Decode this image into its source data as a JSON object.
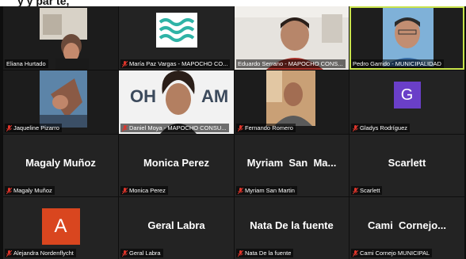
{
  "colors": {
    "tile_bg": "#232323",
    "active_border": "#c8e24a",
    "mute_icon": "#e0352b",
    "avatar_g": "#6a3fc8",
    "avatar_a": "#d9461f"
  },
  "participants": [
    {
      "name": "Eliana Hurtado",
      "muted": false,
      "type": "video"
    },
    {
      "name": "María Paz Vargas - MAPOCHO CO...",
      "muted": true,
      "type": "logo"
    },
    {
      "name": "Eduardo Serrano - MAPOCHO CONS...",
      "muted": false,
      "type": "video"
    },
    {
      "name": "Pedro Garrido - MUNICIPALIDAD",
      "muted": false,
      "type": "video",
      "active": true
    },
    {
      "name": "Jaqueline Pizarro",
      "muted": true,
      "type": "video"
    },
    {
      "name": "Daniel Moya - MAPOCHO CONSU...",
      "muted": true,
      "type": "video",
      "banner_text": "OH          AM"
    },
    {
      "name": "Fernando Romero",
      "muted": true,
      "type": "video"
    },
    {
      "name": "Gladys Rodríguez",
      "muted": true,
      "type": "avatar",
      "initial": "G"
    },
    {
      "name": "Magaly Muñoz",
      "display": "Magaly Muñoz",
      "muted": true,
      "type": "name"
    },
    {
      "name": "Monica Perez",
      "display": "Monica Perez",
      "muted": true,
      "type": "name"
    },
    {
      "name": "Myriam San Martin",
      "display": "Myriam  San  Ma...",
      "muted": true,
      "type": "name"
    },
    {
      "name": "Scarlett",
      "display": "Scarlett",
      "muted": true,
      "type": "name"
    },
    {
      "name": "Alejandra Nordenflycht",
      "muted": true,
      "type": "avatar",
      "initial": "A"
    },
    {
      "name": "Geral Labra",
      "display": "Geral Labra",
      "muted": true,
      "type": "name"
    },
    {
      "name": "Nata De la fuente",
      "display": "Nata De la fuente",
      "muted": true,
      "type": "name"
    },
    {
      "name": "Cami Cornejo MUNICIPAL",
      "display": "Cami  Cornejo...",
      "muted": true,
      "type": "name"
    }
  ]
}
